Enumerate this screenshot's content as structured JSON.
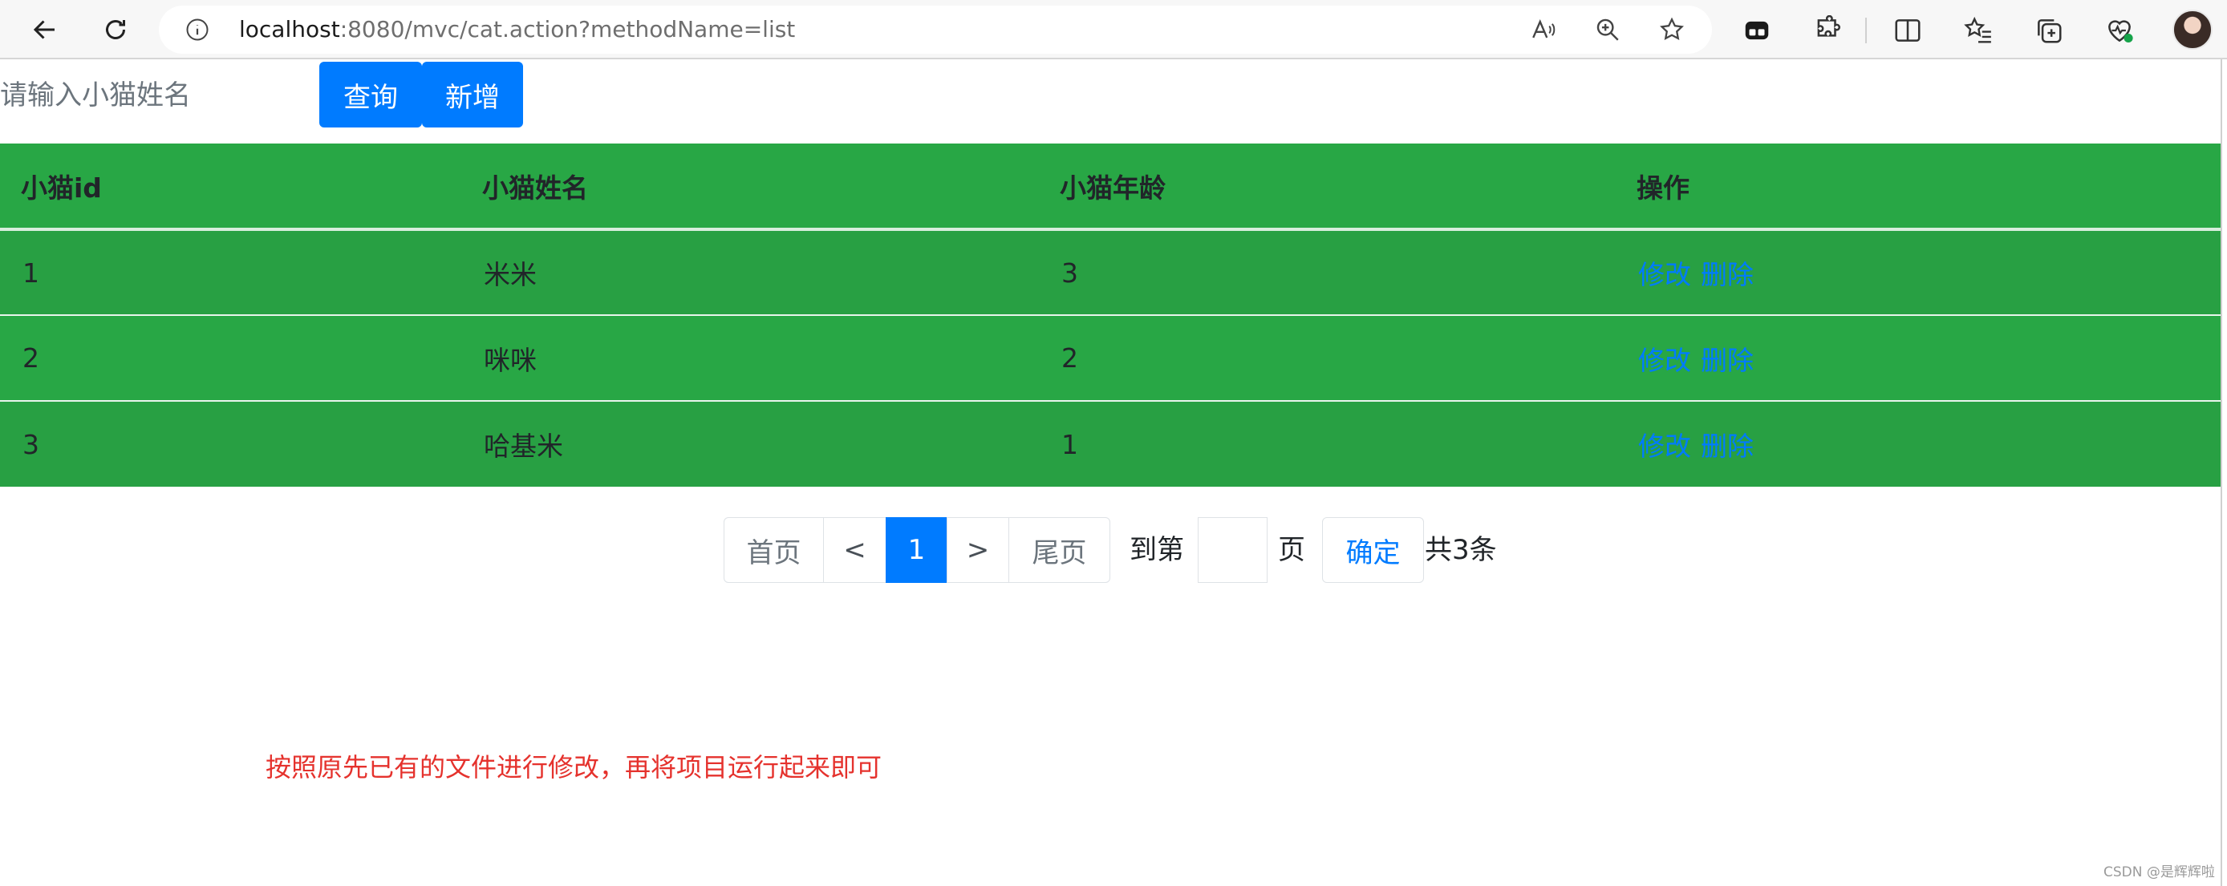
{
  "browser": {
    "url_host": "localhost",
    "url_rest": ":8080/mvc/cat.action?methodName=list",
    "icons": [
      "back-arrow-icon",
      "refresh-icon",
      "info-icon",
      "read-aloud-icon",
      "zoom-icon",
      "favorite-star-icon",
      "extension-tile-icon",
      "extensions-puzzle-icon",
      "split-screen-icon",
      "favorites-list-icon",
      "collections-icon",
      "browser-essentials-icon",
      "profile-avatar"
    ]
  },
  "search": {
    "placeholder": "请输入小猫姓名",
    "query_label": "查询",
    "add_label": "新增"
  },
  "table": {
    "headers": [
      "小猫id",
      "小猫姓名",
      "小猫年龄",
      "操作"
    ],
    "rows": [
      {
        "id": "1",
        "name": "米米",
        "age": "3",
        "edit": "修改",
        "delete": "删除"
      },
      {
        "id": "2",
        "name": "咪咪",
        "age": "2",
        "edit": "修改",
        "delete": "删除"
      },
      {
        "id": "3",
        "name": "哈基米",
        "age": "1",
        "edit": "修改",
        "delete": "删除"
      }
    ],
    "header_color": "#28a745",
    "link_color": "#007bff"
  },
  "pagination": {
    "first": "首页",
    "prev": "<",
    "current": "1",
    "next": ">",
    "last": "尾页",
    "goto_prefix": "到第",
    "goto_suffix": "页",
    "confirm": "确定",
    "total": "共3条",
    "active_color": "#007bff"
  },
  "note": "按照原先已有的文件进行修改，再将项目运行起来即可",
  "watermark": "CSDN @是辉辉啦"
}
